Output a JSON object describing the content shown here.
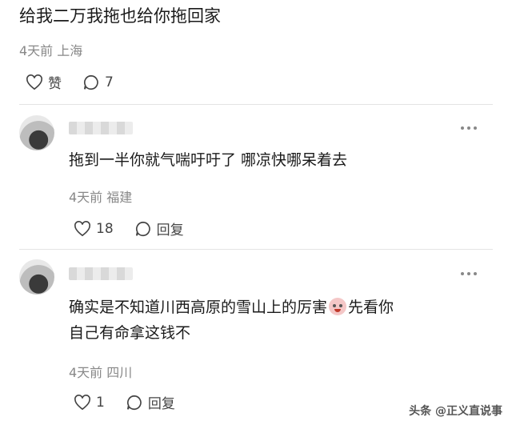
{
  "top_comment": {
    "text": "给我二万我拖也给你拖回家",
    "meta": "4天前 上海",
    "like_label": "赞",
    "reply_count": "7"
  },
  "replies": [
    {
      "text_lines": [
        "拖到一半你就气喘吁吁了 哪凉快哪呆着去"
      ],
      "meta": "4天前 福建",
      "like_count": "18",
      "reply_label": "回复"
    },
    {
      "text_lines": [
        "确实是不知道川西高原的雪山上的厉害",
        "先看你",
        "自己有命拿这钱不"
      ],
      "emoji_icon": "crying-clown-emoji",
      "meta": "4天前 四川",
      "like_count": "1",
      "reply_label": "回复"
    }
  ],
  "watermark": "头条 @正义直说事"
}
